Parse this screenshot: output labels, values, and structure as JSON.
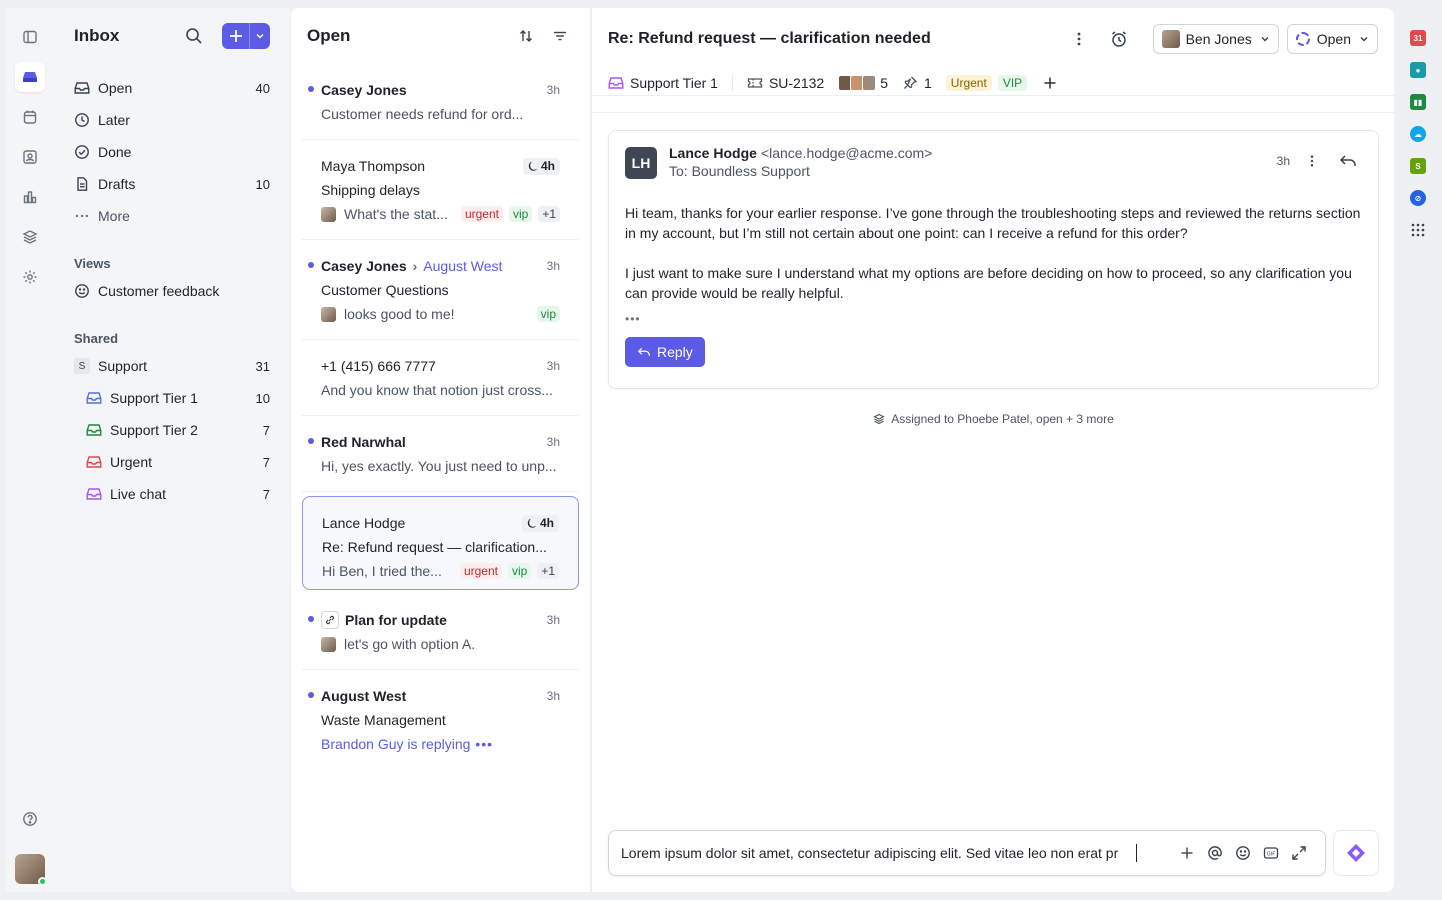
{
  "sidebar": {
    "title": "Inbox",
    "nav": [
      {
        "label": "Open",
        "count": "40"
      },
      {
        "label": "Later",
        "count": ""
      },
      {
        "label": "Done",
        "count": ""
      },
      {
        "label": "Drafts",
        "count": "10"
      },
      {
        "label": "More",
        "count": ""
      }
    ],
    "views_label": "Views",
    "views": [
      {
        "label": "Customer feedback"
      }
    ],
    "shared_label": "Shared",
    "support": {
      "letter": "S",
      "label": "Support",
      "count": "31"
    },
    "shared": [
      {
        "label": "Support Tier 1",
        "count": "10",
        "color": "#5b6be6"
      },
      {
        "label": "Support Tier 2",
        "count": "7",
        "color": "#1c8a3f"
      },
      {
        "label": "Urgent",
        "count": "7",
        "color": "#e0474c"
      },
      {
        "label": "Live chat",
        "count": "7",
        "color": "#a855f7"
      }
    ]
  },
  "list": {
    "title": "Open",
    "conversations": [
      {
        "name": "Casey Jones",
        "time": "3h",
        "preview": "Customer needs refund for ord..."
      },
      {
        "name": "Maya Thompson",
        "time": "4h",
        "subject": "Shipping delays",
        "preview": "What's the stat...",
        "tags": [
          "urgent",
          "vip",
          "+1"
        ]
      },
      {
        "name": "Casey Jones",
        "to": "August West",
        "time": "3h",
        "subject": "Customer Questions",
        "preview": "looks good to me!",
        "tags": [
          "vip"
        ]
      },
      {
        "name": "+1 (415) 666 7777",
        "time": "3h",
        "preview": "And you know that notion just cross..."
      },
      {
        "name": "Red Narwhal",
        "time": "3h",
        "preview": "Hi, yes exactly. You just need to unp..."
      },
      {
        "name": "Lance Hodge",
        "time": "4h",
        "subject": "Re: Refund request — clarification...",
        "preview": "Hi Ben, I tried the...",
        "tags": [
          "urgent",
          "vip",
          "+1"
        ]
      },
      {
        "name": "Plan for update",
        "time": "3h",
        "preview": "let's go with option A."
      },
      {
        "name": "August West",
        "time": "3h",
        "subject": "Waste Management",
        "preview": "Brandon Guy is replying"
      }
    ]
  },
  "main": {
    "title": "Re: Refund request — clarification needed",
    "assignee": "Ben Jones",
    "status": "Open",
    "meta": {
      "inbox": "Support Tier 1",
      "ticket": "SU-2132",
      "participants": "5",
      "pins": "1",
      "tags": [
        "Urgent",
        "VIP"
      ]
    },
    "message": {
      "initials": "LH",
      "sender": "Lance Hodge",
      "email": "<lance.hodge@acme.com>",
      "to": "To: Boundless Support",
      "time": "3h",
      "para1": "Hi team, thanks for your earlier response. I’ve gone through the troubleshooting steps and reviewed the returns section in my account, but I’m still not certain about one point: can I receive a refund for this order?",
      "para2": "I just want to make sure I understand what my options are before deciding on how to proceed, so any clarification you can provide would be really helpful.",
      "reply_label": "Reply"
    },
    "activity": "Assigned to Phoebe Patel, open + 3 more",
    "composer_text": "Lorem ipsum dolor sit amet, consectetur adipiscing elit. Sed vitae leo non erat pr"
  },
  "colors": {
    "accent": "#5b5be6",
    "urgent": "#c0292d",
    "vip": "#1c8a3f"
  }
}
